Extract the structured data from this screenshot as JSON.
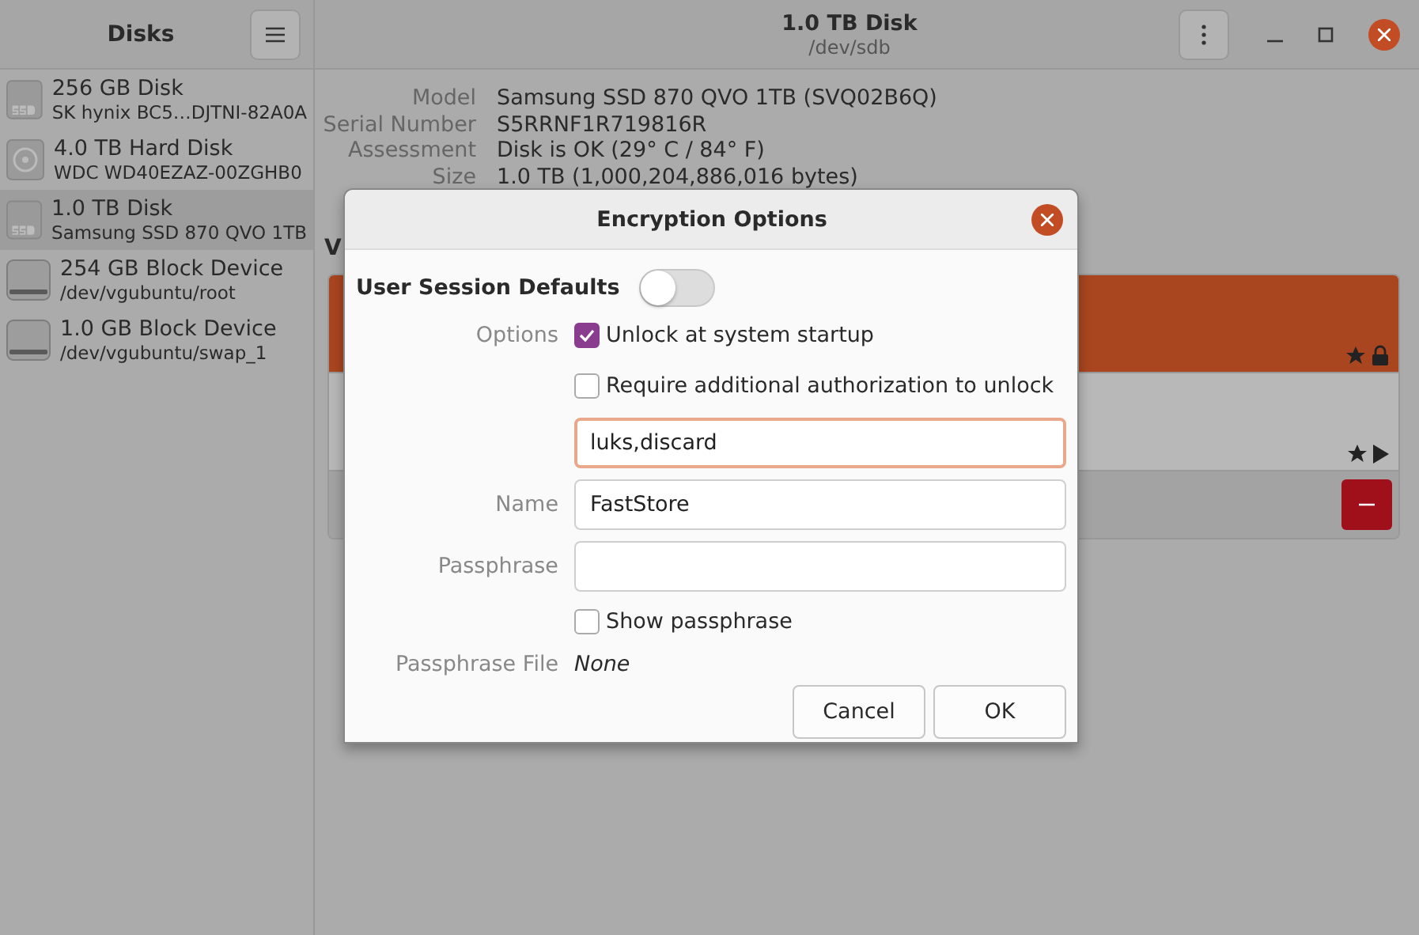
{
  "window": {
    "title": "1.0 TB Disk",
    "subtitle": "/dev/sdb"
  },
  "sidebar": {
    "title": "Disks",
    "items": [
      {
        "kind": "ssd",
        "name": "256 GB Disk",
        "detail": "SK hynix BC5…DJTNI-82A0A",
        "selected": false
      },
      {
        "kind": "hdd",
        "name": "4.0 TB Hard Disk",
        "detail": "WDC WD40EZAZ-00ZGHB0",
        "selected": false
      },
      {
        "kind": "ssd",
        "name": "1.0 TB Disk",
        "detail": "Samsung SSD 870 QVO 1TB",
        "selected": true
      },
      {
        "kind": "block",
        "name": "254 GB Block Device",
        "detail": "/dev/vgubuntu/root",
        "selected": false
      },
      {
        "kind": "block",
        "name": "1.0 GB Block Device",
        "detail": "/dev/vgubuntu/swap_1",
        "selected": false
      }
    ]
  },
  "details": [
    {
      "label": "Model",
      "value": "Samsung SSD 870 QVO 1TB (SVQ02B6Q)"
    },
    {
      "label": "Serial Number",
      "value": "S5RRNF1R719816R"
    },
    {
      "label": "Assessment",
      "value": "Disk is OK (29° C / 84° F)"
    },
    {
      "label": "Size",
      "value": "1.0 TB (1,000,204,886,016 bytes)"
    }
  ],
  "volumes": {
    "heading": "V",
    "segments": [
      {
        "kind": "encrypted",
        "selected": true
      },
      {
        "kind": "filesystem",
        "selected": false
      }
    ]
  },
  "dialog": {
    "title": "Encryption Options",
    "defaults_label": "User Session Defaults",
    "defaults_on": false,
    "options_label": "Options",
    "checkboxes": [
      {
        "label": "Unlock at system startup",
        "checked": true
      },
      {
        "label": "Require additional authorization to unlock",
        "checked": false
      }
    ],
    "options_value": "luks,discard",
    "name_label": "Name",
    "name_value": "FastStore",
    "passphrase_label": "Passphrase",
    "show_passphrase": {
      "label": "Show passphrase",
      "checked": false
    },
    "file_label": "Passphrase File",
    "file_value": "None",
    "buttons": [
      "Cancel",
      "OK"
    ]
  }
}
